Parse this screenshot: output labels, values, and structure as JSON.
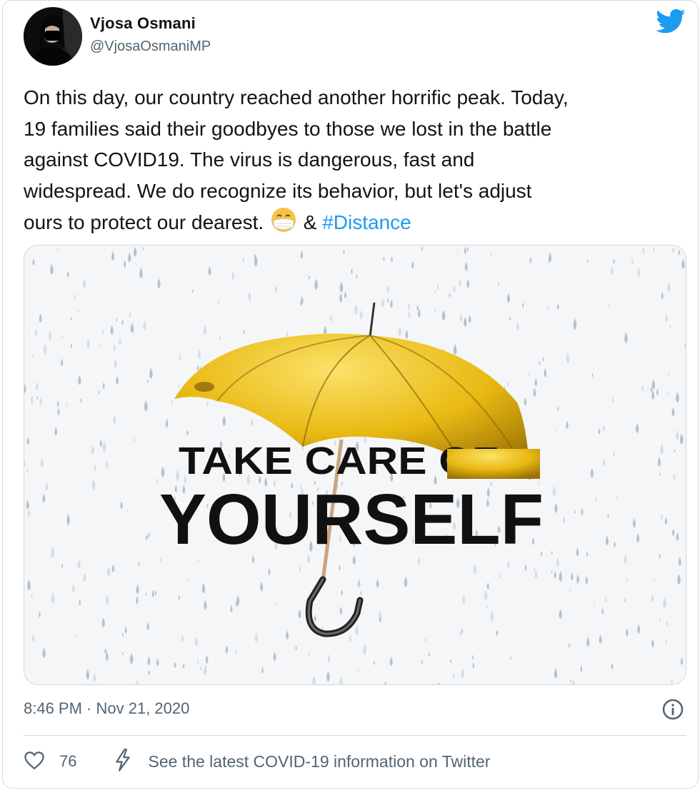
{
  "author": {
    "display_name": "Vjosa Osmani",
    "handle": "@VjosaOsmaniMP"
  },
  "tweet": {
    "text_lines": [
      "On this day, our country reached another horrific peak. Today,",
      "19 families said their goodbyes to those we lost in the battle",
      "against COVID19. The virus is dangerous, fast and",
      "widespread. We do recognize its behavior, but let's adjust",
      "ours to protect our dearest."
    ],
    "text_joiner": "&",
    "hashtag": "#Distance",
    "timestamp": "8:46 PM · Nov 21, 2020"
  },
  "media": {
    "headline_line1": "TAKE CARE OF",
    "headline_line2": "YOURSELF"
  },
  "actions": {
    "like_count": "76",
    "info_link": "See the latest COVID-19 information on Twitter"
  },
  "icons": {
    "brand": "twitter-bird-icon",
    "emoji": "face-with-medical-mask-icon",
    "info": "info-circle-icon",
    "like": "heart-icon",
    "info_link": "lightning-bolt-icon"
  },
  "colors": {
    "brand_blue": "#1d9bf0",
    "secondary_text": "#536471",
    "border": "#cfd9de",
    "umbrella_yellow": "#e9b912"
  }
}
